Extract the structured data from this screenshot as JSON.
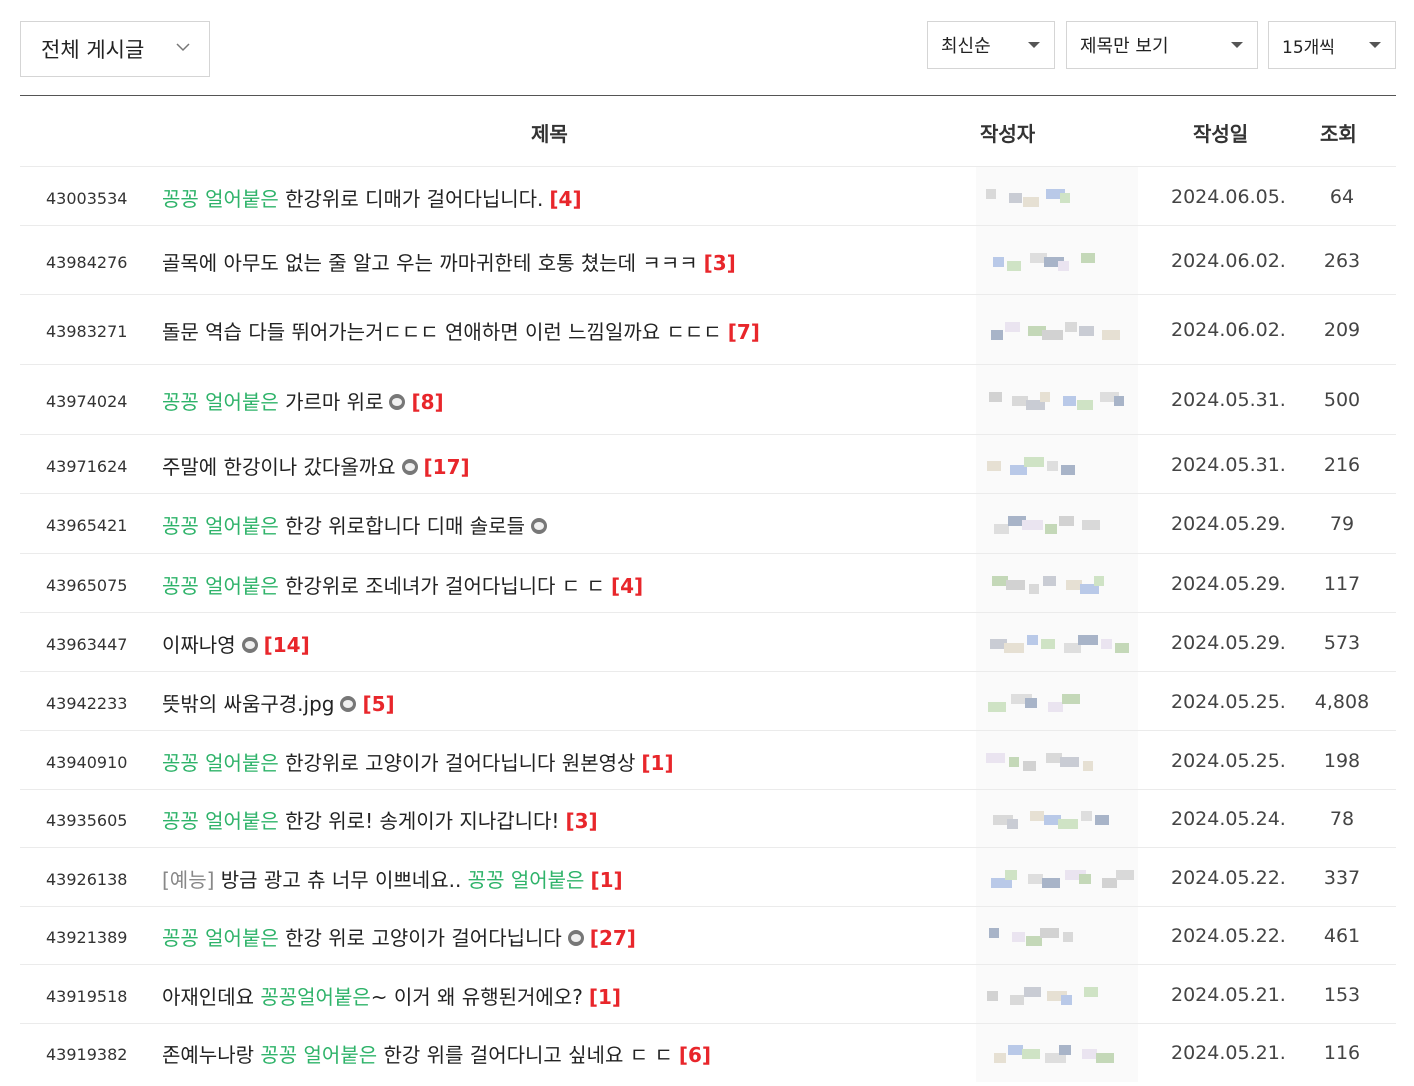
{
  "toolbar": {
    "board_filter": "전체 게시글",
    "sort": "최신순",
    "view_mode": "제목만 보기",
    "per_page": "15개씩"
  },
  "table": {
    "headers": {
      "title": "제목",
      "author": "작성자",
      "date": "작성일",
      "views": "조회"
    },
    "rows": [
      {
        "num": "43003534",
        "parts": [
          [
            "hl",
            "꽁꽁 얼어붙은"
          ],
          [
            "t",
            " 한강위로 디매가 걸어다닙니다."
          ],
          [
            "cnt",
            "[4]"
          ]
        ],
        "date": "2024.06.05.",
        "views": "64"
      },
      {
        "num": "43984276",
        "parts": [
          [
            "t",
            "골목에 아무도 없는 줄 알고 우는 까마귀한테 호통 쳤는데 ㅋㅋㅋ"
          ],
          [
            "cnt",
            "[3]"
          ]
        ],
        "date": "2024.06.02.",
        "views": "263"
      },
      {
        "num": "43983271",
        "parts": [
          [
            "t",
            "돌문 역습 다들 뛰어가는거ㄷㄷㄷ 연애하면 이런 느낌일까요 ㄷㄷㄷ"
          ],
          [
            "cnt",
            "[7]"
          ]
        ],
        "date": "2024.06.02.",
        "views": "209"
      },
      {
        "num": "43974024",
        "parts": [
          [
            "hl",
            "꽁꽁 얼어붙은"
          ],
          [
            "t",
            " 가르마 위로"
          ],
          [
            "img",
            ""
          ],
          [
            "cnt",
            "[8]"
          ]
        ],
        "date": "2024.05.31.",
        "views": "500"
      },
      {
        "num": "43971624",
        "parts": [
          [
            "t",
            "주말에 한강이나 갔다올까요"
          ],
          [
            "img",
            ""
          ],
          [
            "cnt",
            "[17]"
          ]
        ],
        "date": "2024.05.31.",
        "views": "216"
      },
      {
        "num": "43965421",
        "parts": [
          [
            "hl",
            "꽁꽁 얼어붙은"
          ],
          [
            "t",
            " 한강 위로합니다 디매 솔로들"
          ],
          [
            "img",
            ""
          ]
        ],
        "date": "2024.05.29.",
        "views": "79"
      },
      {
        "num": "43965075",
        "parts": [
          [
            "hl",
            "꽁꽁 얼어붙은"
          ],
          [
            "t",
            " 한강위로 조네녀가 걸어다닙니다 ㄷ ㄷ"
          ],
          [
            "cnt",
            "[4]"
          ]
        ],
        "date": "2024.05.29.",
        "views": "117"
      },
      {
        "num": "43963447",
        "parts": [
          [
            "t",
            "이짜나영"
          ],
          [
            "img",
            ""
          ],
          [
            "cnt",
            "[14]"
          ]
        ],
        "date": "2024.05.29.",
        "views": "573"
      },
      {
        "num": "43942233",
        "parts": [
          [
            "t",
            "뜻밖의 싸움구경.jpg"
          ],
          [
            "img",
            ""
          ],
          [
            "cnt",
            "[5]"
          ]
        ],
        "date": "2024.05.25.",
        "views": "4,808"
      },
      {
        "num": "43940910",
        "parts": [
          [
            "hl",
            "꽁꽁 얼어붙은"
          ],
          [
            "t",
            " 한강위로 고양이가 걸어다닙니다 원본영상"
          ],
          [
            "cnt",
            "[1]"
          ]
        ],
        "date": "2024.05.25.",
        "views": "198"
      },
      {
        "num": "43935605",
        "parts": [
          [
            "hl",
            "꽁꽁 얼어붙은"
          ],
          [
            "t",
            " 한강 위로! 송게이가 지나갑니다!"
          ],
          [
            "cnt",
            "[3]"
          ]
        ],
        "date": "2024.05.24.",
        "views": "78"
      },
      {
        "num": "43926138",
        "parts": [
          [
            "tag",
            "[예능]"
          ],
          [
            "t",
            " 방금 광고 츄 너무 이쁘네요.. "
          ],
          [
            "hl",
            "꽁꽁 얼어붙은"
          ],
          [
            "cnt",
            "[1]"
          ]
        ],
        "date": "2024.05.22.",
        "views": "337"
      },
      {
        "num": "43921389",
        "parts": [
          [
            "hl",
            "꽁꽁 얼어붙은"
          ],
          [
            "t",
            " 한강 위로 고양이가 걸어다닙니다"
          ],
          [
            "img",
            ""
          ],
          [
            "cnt",
            "[27]"
          ]
        ],
        "date": "2024.05.22.",
        "views": "461"
      },
      {
        "num": "43919518",
        "parts": [
          [
            "t",
            "아재인데요 "
          ],
          [
            "hl",
            "꽁꽁얼어붙은"
          ],
          [
            "t",
            "~ 이거 왜 유행된거에오?"
          ],
          [
            "cnt",
            "[1]"
          ]
        ],
        "date": "2024.05.21.",
        "views": "153"
      },
      {
        "num": "43919382",
        "parts": [
          [
            "t",
            "존예누나랑 "
          ],
          [
            "hl",
            "꽁꽁 얼어붙은"
          ],
          [
            "t",
            " 한강 위를 걸어다니고 싶네요 ㄷ ㄷ"
          ],
          [
            "cnt",
            "[6]"
          ]
        ],
        "date": "2024.05.21.",
        "views": "116"
      }
    ]
  },
  "colors": {
    "highlight": "#2fb36a",
    "comment_count": "#e8262b",
    "tag": "#888888"
  }
}
